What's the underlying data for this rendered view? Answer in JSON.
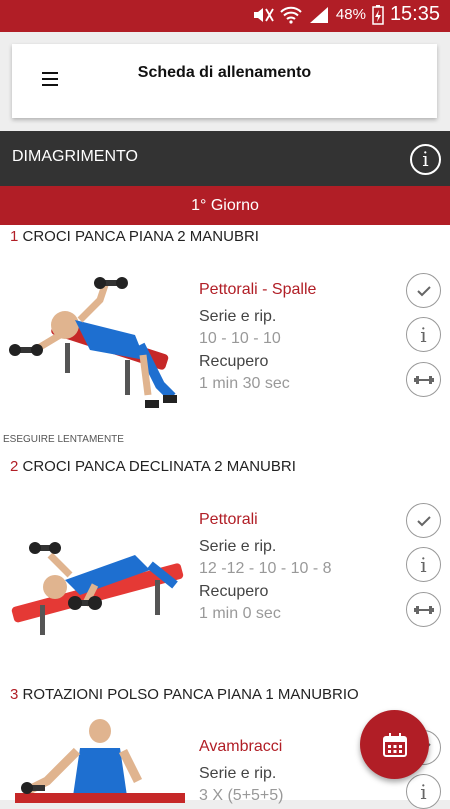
{
  "status": {
    "battery": "48%",
    "time": "15:35"
  },
  "appbar": {
    "title": "Scheda di allenamento"
  },
  "program": {
    "name": "DIMAGRIMENTO"
  },
  "day": {
    "label": "1° Giorno"
  },
  "exercises": [
    {
      "number": "1",
      "name": "CROCI PANCA PIANA 2 MANUBRI",
      "muscles": "Pettorali - Spalle",
      "sets_label": "Serie e rip.",
      "sets": "10 - 10 - 10",
      "rest_label": "Recupero",
      "rest": "1 min 30 sec",
      "note": "ESEGUIRE LENTAMENTE"
    },
    {
      "number": "2",
      "name": "CROCI PANCA DECLINATA 2 MANUBRI",
      "muscles": "Pettorali",
      "sets_label": "Serie e rip.",
      "sets": "12 -12 - 10 - 10 - 8",
      "rest_label": "Recupero",
      "rest": "1 min 0 sec"
    },
    {
      "number": "3",
      "name": "ROTAZIONI POLSO PANCA PIANA 1 MANUBRIO",
      "muscles": "Avambracci",
      "sets_label": "Serie e rip.",
      "sets": "3 X (5+5+5)"
    }
  ],
  "colors": {
    "accent": "#b11e26",
    "dark_header": "#333333"
  }
}
